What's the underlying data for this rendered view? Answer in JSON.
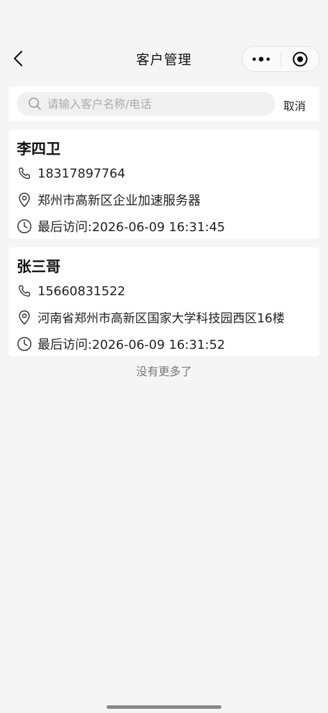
{
  "navbar": {
    "title": "客户管理",
    "back_icon": "chevron-left-icon",
    "more_icon": "more-dots-icon",
    "close_icon": "target-circle-icon"
  },
  "search": {
    "placeholder": "请输入客户名称/电话",
    "value": "",
    "cancel_label": "取消"
  },
  "customers": [
    {
      "name": "李四卫",
      "phone": "18317897764",
      "address": "郑州市高新区企业加速服务器",
      "last_visit": "最后访问:2026-06-09 16:31:45"
    },
    {
      "name": "张三哥",
      "phone": "15660831522",
      "address": "河南省郑州市高新区国家大学科技园西区16楼",
      "last_visit": "最后访问:2026-06-09 16:31:52"
    }
  ],
  "footer": {
    "no_more": "没有更多了"
  }
}
